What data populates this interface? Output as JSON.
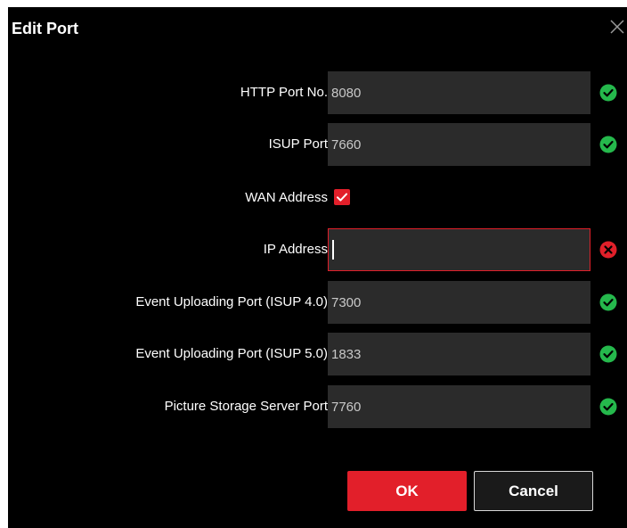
{
  "dialog": {
    "title": "Edit Port",
    "close_icon": "close-icon"
  },
  "fields": {
    "http_port": {
      "label": "HTTP Port No.",
      "value": "8080",
      "status": "valid"
    },
    "isup_port": {
      "label": "ISUP Port",
      "value": "7660",
      "status": "valid"
    },
    "wan_address": {
      "label": "WAN Address",
      "checked": true
    },
    "ip_address": {
      "label": "IP Address",
      "value": "",
      "status": "invalid"
    },
    "event_port_isup4": {
      "label": "Event Uploading Port (ISUP 4.0)",
      "value": "7300",
      "status": "valid"
    },
    "event_port_isup5": {
      "label": "Event Uploading Port (ISUP 5.0)",
      "value": "1833",
      "status": "valid"
    },
    "picture_storage_port": {
      "label": "Picture Storage Server Port",
      "value": "7760",
      "status": "valid"
    }
  },
  "buttons": {
    "ok_label": "OK",
    "cancel_label": "Cancel"
  },
  "icons": {
    "valid": "check-circle-icon",
    "invalid": "error-circle-icon",
    "checkbox": "checkmark-icon"
  },
  "colors": {
    "background": "#000000",
    "field_background": "#2b2b2b",
    "accent_red": "#e21f2a",
    "valid_green": "#25b84c",
    "invalid_red": "#e0202a",
    "text": "#ffffff"
  }
}
